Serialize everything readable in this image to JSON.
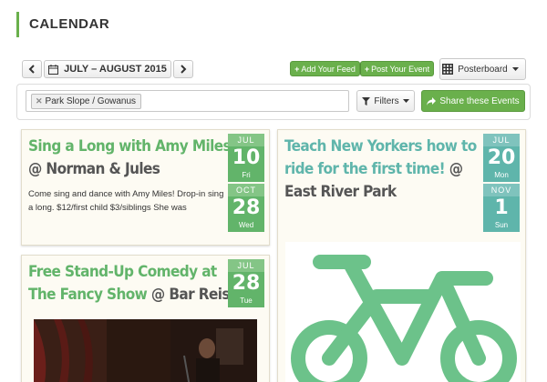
{
  "header": {
    "title": "CALENDAR"
  },
  "toolbar": {
    "date_range": "JULY – AUGUST 2015",
    "add_feed": "Add Your Feed",
    "post_event": "Post Your Event",
    "view_mode": "Posterboard"
  },
  "filter": {
    "tag": "Park Slope / Gowanus",
    "filters_label": "Filters",
    "share_label": "Share these Events"
  },
  "events": [
    {
      "name": "Sing a Long with Amy Miles",
      "venue": "@ Norman & Jules",
      "description": "Come sing and dance with Amy Miles! Drop-in sing a long. $12/first child $3/siblings She was",
      "start": {
        "month": "JUL",
        "day": "10",
        "weekday": "Fri"
      },
      "end": {
        "month": "OCT",
        "day": "28",
        "weekday": "Wed"
      }
    },
    {
      "name": "Free Stand-Up Comedy at The Fancy Show",
      "venue": "@ Bar Reis",
      "start": {
        "month": "JUL",
        "day": "28",
        "weekday": "Tue"
      }
    },
    {
      "name": "Teach New Yorkers how to ride for the first time!",
      "venue": "@ East River Park",
      "start": {
        "month": "JUL",
        "day": "20",
        "weekday": "Mon"
      },
      "end": {
        "month": "NOV",
        "day": "1",
        "weekday": "Sun"
      }
    }
  ],
  "colors": {
    "accent_green": "#62b46a",
    "button_green": "#6ab04c",
    "date_teal": "#5fb5ab",
    "card_bg": "#fdfbf3"
  }
}
